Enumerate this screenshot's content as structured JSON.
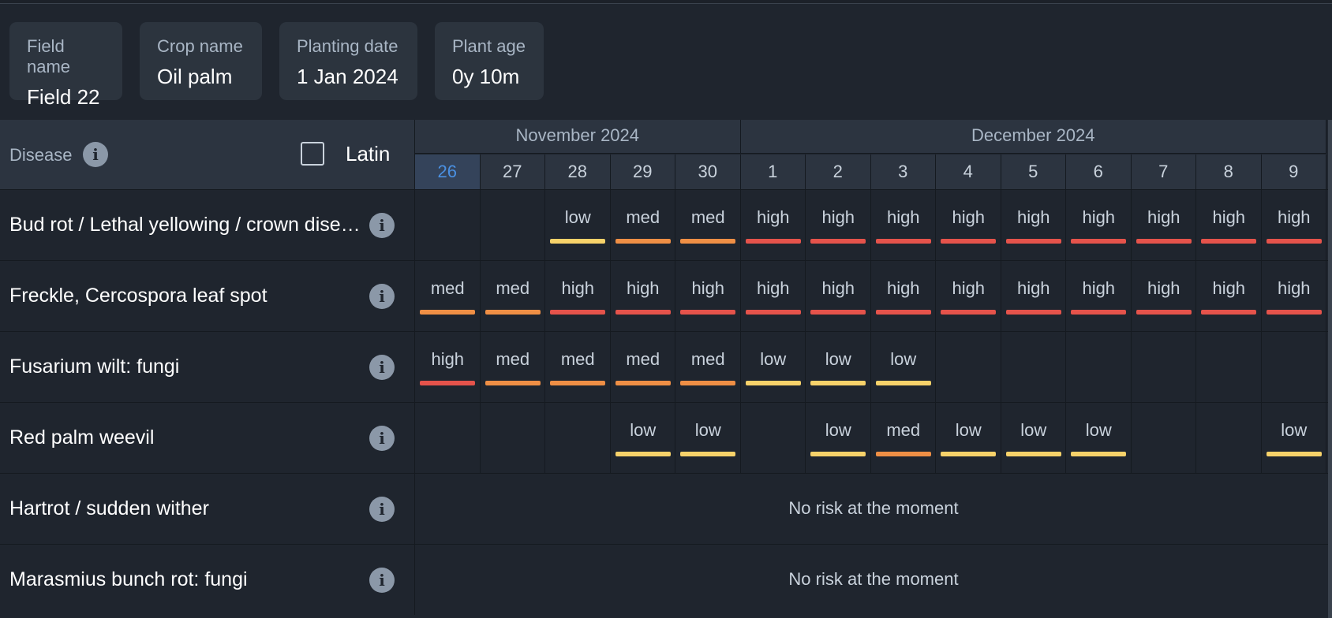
{
  "info_cards": [
    {
      "label": "Field name",
      "value": "Field 22"
    },
    {
      "label": "Crop name",
      "value": "Oil palm"
    },
    {
      "label": "Planting date",
      "value": "1 Jan 2024"
    },
    {
      "label": "Plant age",
      "value": "0y 10m"
    }
  ],
  "header": {
    "disease_label": "Disease",
    "latin_label": "Latin",
    "latin_checked": false,
    "months": [
      {
        "label": "November 2024",
        "days": 5
      },
      {
        "label": "December 2024",
        "days": 9
      }
    ],
    "days": [
      "26",
      "27",
      "28",
      "29",
      "30",
      "1",
      "2",
      "3",
      "4",
      "5",
      "6",
      "7",
      "8",
      "9"
    ],
    "today": "26"
  },
  "risk_colors": {
    "low": "#f7d26a",
    "med": "#ef8f45",
    "high": "#e5534b"
  },
  "rows": [
    {
      "name": "Bud rot / Lethal yellowing / crown disease",
      "risks": [
        "",
        "",
        "low",
        "med",
        "med",
        "high",
        "high",
        "high",
        "high",
        "high",
        "high",
        "high",
        "high",
        "high"
      ]
    },
    {
      "name": "Freckle, Cercospora leaf spot",
      "risks": [
        "med",
        "med",
        "high",
        "high",
        "high",
        "high",
        "high",
        "high",
        "high",
        "high",
        "high",
        "high",
        "high",
        "high"
      ]
    },
    {
      "name": "Fusarium wilt: fungi",
      "risks": [
        "high",
        "med",
        "med",
        "med",
        "med",
        "low",
        "low",
        "low",
        "",
        "",
        "",
        "",
        "",
        ""
      ]
    },
    {
      "name": "Red palm weevil",
      "risks": [
        "",
        "",
        "",
        "low",
        "low",
        "",
        "low",
        "med",
        "low",
        "low",
        "low",
        "",
        "",
        "low"
      ]
    },
    {
      "name": "Hartrot / sudden wither",
      "no_risk": "No risk at the moment"
    },
    {
      "name": "Marasmius bunch rot: fungi",
      "no_risk": "No risk at the moment"
    }
  ]
}
